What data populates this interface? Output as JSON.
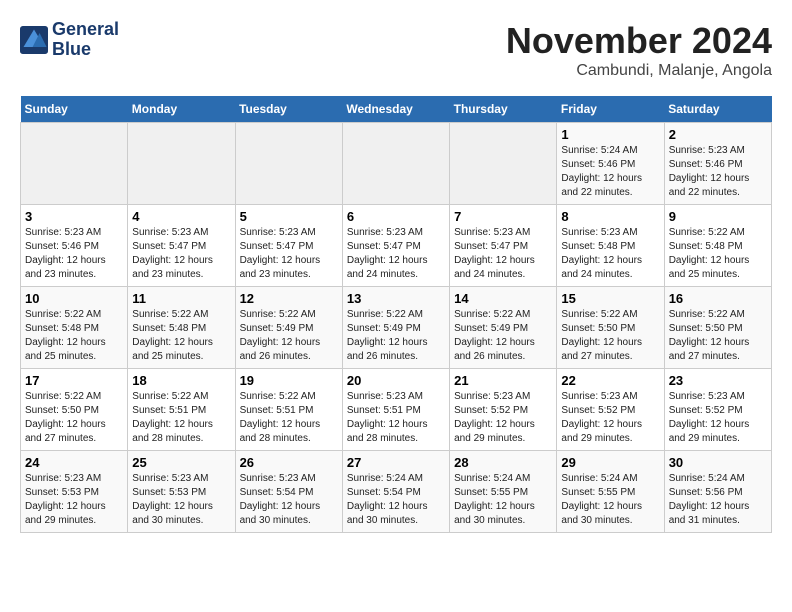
{
  "header": {
    "logo_line1": "General",
    "logo_line2": "Blue",
    "month": "November 2024",
    "location": "Cambundi, Malanje, Angola"
  },
  "columns": [
    "Sunday",
    "Monday",
    "Tuesday",
    "Wednesday",
    "Thursday",
    "Friday",
    "Saturday"
  ],
  "weeks": [
    [
      {
        "day": "",
        "info": ""
      },
      {
        "day": "",
        "info": ""
      },
      {
        "day": "",
        "info": ""
      },
      {
        "day": "",
        "info": ""
      },
      {
        "day": "",
        "info": ""
      },
      {
        "day": "1",
        "info": "Sunrise: 5:24 AM\nSunset: 5:46 PM\nDaylight: 12 hours and 22 minutes."
      },
      {
        "day": "2",
        "info": "Sunrise: 5:23 AM\nSunset: 5:46 PM\nDaylight: 12 hours and 22 minutes."
      }
    ],
    [
      {
        "day": "3",
        "info": "Sunrise: 5:23 AM\nSunset: 5:46 PM\nDaylight: 12 hours and 23 minutes."
      },
      {
        "day": "4",
        "info": "Sunrise: 5:23 AM\nSunset: 5:47 PM\nDaylight: 12 hours and 23 minutes."
      },
      {
        "day": "5",
        "info": "Sunrise: 5:23 AM\nSunset: 5:47 PM\nDaylight: 12 hours and 23 minutes."
      },
      {
        "day": "6",
        "info": "Sunrise: 5:23 AM\nSunset: 5:47 PM\nDaylight: 12 hours and 24 minutes."
      },
      {
        "day": "7",
        "info": "Sunrise: 5:23 AM\nSunset: 5:47 PM\nDaylight: 12 hours and 24 minutes."
      },
      {
        "day": "8",
        "info": "Sunrise: 5:23 AM\nSunset: 5:48 PM\nDaylight: 12 hours and 24 minutes."
      },
      {
        "day": "9",
        "info": "Sunrise: 5:22 AM\nSunset: 5:48 PM\nDaylight: 12 hours and 25 minutes."
      }
    ],
    [
      {
        "day": "10",
        "info": "Sunrise: 5:22 AM\nSunset: 5:48 PM\nDaylight: 12 hours and 25 minutes."
      },
      {
        "day": "11",
        "info": "Sunrise: 5:22 AM\nSunset: 5:48 PM\nDaylight: 12 hours and 25 minutes."
      },
      {
        "day": "12",
        "info": "Sunrise: 5:22 AM\nSunset: 5:49 PM\nDaylight: 12 hours and 26 minutes."
      },
      {
        "day": "13",
        "info": "Sunrise: 5:22 AM\nSunset: 5:49 PM\nDaylight: 12 hours and 26 minutes."
      },
      {
        "day": "14",
        "info": "Sunrise: 5:22 AM\nSunset: 5:49 PM\nDaylight: 12 hours and 26 minutes."
      },
      {
        "day": "15",
        "info": "Sunrise: 5:22 AM\nSunset: 5:50 PM\nDaylight: 12 hours and 27 minutes."
      },
      {
        "day": "16",
        "info": "Sunrise: 5:22 AM\nSunset: 5:50 PM\nDaylight: 12 hours and 27 minutes."
      }
    ],
    [
      {
        "day": "17",
        "info": "Sunrise: 5:22 AM\nSunset: 5:50 PM\nDaylight: 12 hours and 27 minutes."
      },
      {
        "day": "18",
        "info": "Sunrise: 5:22 AM\nSunset: 5:51 PM\nDaylight: 12 hours and 28 minutes."
      },
      {
        "day": "19",
        "info": "Sunrise: 5:22 AM\nSunset: 5:51 PM\nDaylight: 12 hours and 28 minutes."
      },
      {
        "day": "20",
        "info": "Sunrise: 5:23 AM\nSunset: 5:51 PM\nDaylight: 12 hours and 28 minutes."
      },
      {
        "day": "21",
        "info": "Sunrise: 5:23 AM\nSunset: 5:52 PM\nDaylight: 12 hours and 29 minutes."
      },
      {
        "day": "22",
        "info": "Sunrise: 5:23 AM\nSunset: 5:52 PM\nDaylight: 12 hours and 29 minutes."
      },
      {
        "day": "23",
        "info": "Sunrise: 5:23 AM\nSunset: 5:52 PM\nDaylight: 12 hours and 29 minutes."
      }
    ],
    [
      {
        "day": "24",
        "info": "Sunrise: 5:23 AM\nSunset: 5:53 PM\nDaylight: 12 hours and 29 minutes."
      },
      {
        "day": "25",
        "info": "Sunrise: 5:23 AM\nSunset: 5:53 PM\nDaylight: 12 hours and 30 minutes."
      },
      {
        "day": "26",
        "info": "Sunrise: 5:23 AM\nSunset: 5:54 PM\nDaylight: 12 hours and 30 minutes."
      },
      {
        "day": "27",
        "info": "Sunrise: 5:24 AM\nSunset: 5:54 PM\nDaylight: 12 hours and 30 minutes."
      },
      {
        "day": "28",
        "info": "Sunrise: 5:24 AM\nSunset: 5:55 PM\nDaylight: 12 hours and 30 minutes."
      },
      {
        "day": "29",
        "info": "Sunrise: 5:24 AM\nSunset: 5:55 PM\nDaylight: 12 hours and 30 minutes."
      },
      {
        "day": "30",
        "info": "Sunrise: 5:24 AM\nSunset: 5:56 PM\nDaylight: 12 hours and 31 minutes."
      }
    ]
  ]
}
